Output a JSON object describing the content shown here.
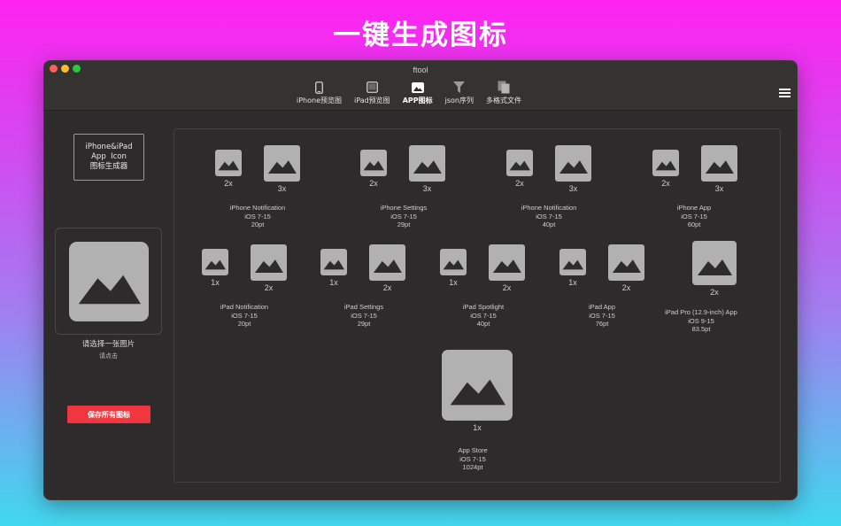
{
  "banner": {
    "title": "一键生成图标"
  },
  "window": {
    "title": "ftool"
  },
  "tabs": [
    {
      "label": "iPhone预览图",
      "icon": "iphone-icon"
    },
    {
      "label": "iPad预览图",
      "icon": "ipad-icon"
    },
    {
      "label": "APP图标",
      "icon": "image-icon",
      "active": true
    },
    {
      "label": "json序列",
      "icon": "filter-icon"
    },
    {
      "label": "多格式文件",
      "icon": "documents-icon"
    }
  ],
  "sidebar": {
    "app_title_line1": "iPhone&iPad",
    "app_title_line2": "App  Icon",
    "app_title_line3": "图标生成器",
    "choose_label": "请选择一张图片",
    "click_hint": "请点击",
    "save_button": "保存所有图标"
  },
  "groups": [
    {
      "name": "iPhone Notification",
      "ios": "iOS 7-15",
      "size": "20pt",
      "scales": [
        "2x",
        "3x"
      ]
    },
    {
      "name": "iPhone Settings",
      "ios": "iOS 7-15",
      "size": "29pt",
      "scales": [
        "2x",
        "3x"
      ]
    },
    {
      "name": "iPhone Notification",
      "ios": "iOS 7-15",
      "size": "40pt",
      "scales": [
        "2x",
        "3x"
      ]
    },
    {
      "name": "iPhone App",
      "ios": "iOS 7-15",
      "size": "60pt",
      "scales": [
        "2x",
        "3x"
      ]
    },
    {
      "name": "iPad Notification",
      "ios": "iOS 7-15",
      "size": "20pt",
      "scales": [
        "1x",
        "2x"
      ]
    },
    {
      "name": "iPad Settings",
      "ios": "iOS 7-15",
      "size": "29pt",
      "scales": [
        "1x",
        "2x"
      ]
    },
    {
      "name": "iPad Spotlight",
      "ios": "iOS 7-15",
      "size": "40pt",
      "scales": [
        "1x",
        "2x"
      ]
    },
    {
      "name": "iPad App",
      "ios": "iOS 7-15",
      "size": "76pt",
      "scales": [
        "1x",
        "2x"
      ]
    },
    {
      "name": "iPad Pro (12.9-inch) App",
      "ios": "iOS 9-15",
      "size": "83.5pt",
      "scales": [
        "2x"
      ]
    },
    {
      "name": "App Store",
      "ios": "iOS 7-15",
      "size": "1024pt",
      "scales": [
        "1x"
      ]
    }
  ]
}
